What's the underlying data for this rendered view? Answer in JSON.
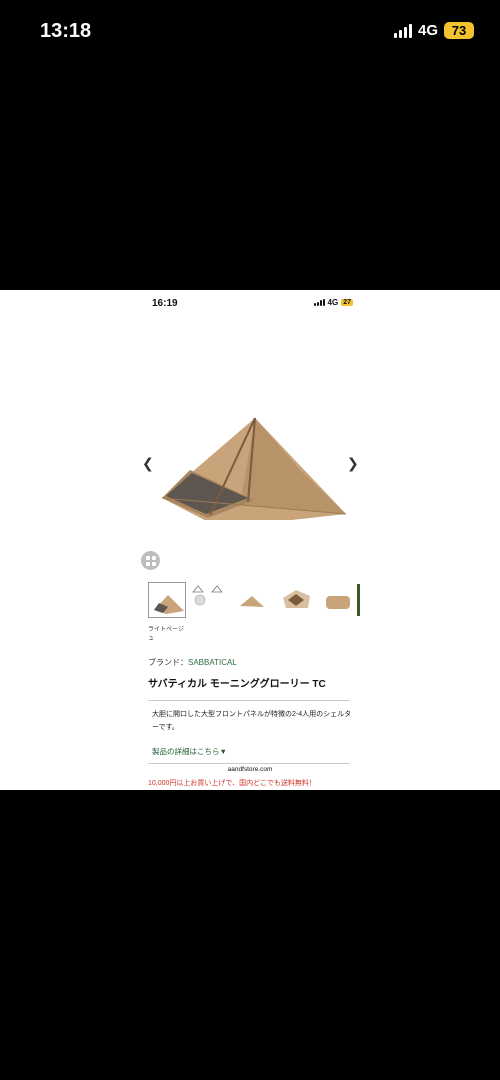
{
  "outer_status": {
    "time": "13:18",
    "network": "4G",
    "battery": "73"
  },
  "inner_status": {
    "time": "16:19",
    "network": "4G",
    "battery": "27"
  },
  "product": {
    "thumb_caption": "ライトページュ",
    "brand_label": "ブランド：",
    "brand_name": "SABBATICAL",
    "title": "サバティカル モーニンググローリー TC",
    "description": "大胆に開口した大型フロントパネルが特徴の2-4人用のシェルターです。",
    "details_link": "製品の詳細はこちら▼",
    "site_url": "aandfstore.com",
    "promo": "10,000円以上お買い上げで、国内どこでも送料無料！"
  },
  "colors": {
    "accent_green": "#2e6b3f",
    "promo_red": "#d0352a",
    "tent_canvas": "#c9a47a"
  }
}
